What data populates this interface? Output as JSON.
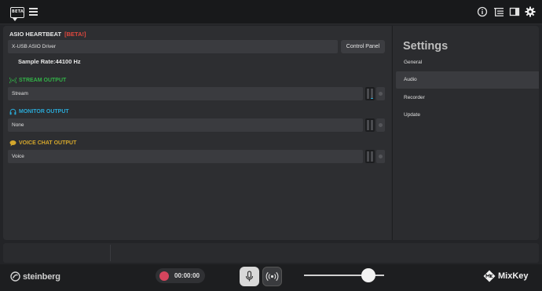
{
  "topbar": {
    "beta_logo_text": "BETA",
    "icons": [
      "info-icon",
      "list-tree-icon",
      "sidebar-toggle-icon",
      "gear-icon"
    ]
  },
  "asio": {
    "title": "ASIO HEARTBEAT",
    "beta_tag": "[BETA!]",
    "driver_value": "X-USB ASIO Driver",
    "control_panel_label": "Control Panel",
    "sample_rate": "Sample Rate:44100 Hz"
  },
  "outputs": {
    "stream": {
      "label": "STREAM OUTPUT",
      "value": "Stream",
      "color": "#33b248"
    },
    "monitor": {
      "label": "MONITOR OUTPUT",
      "value": "None",
      "color": "#2aa9d6"
    },
    "voice": {
      "label": "VOICE CHAT OUTPUT",
      "value": "Voice",
      "color": "#d4a72c"
    }
  },
  "settings": {
    "title": "Settings",
    "items": [
      {
        "label": "General",
        "active": false
      },
      {
        "label": "Audio",
        "active": true
      },
      {
        "label": "Recorder",
        "active": false
      },
      {
        "label": "Update",
        "active": false
      }
    ]
  },
  "bottombar": {
    "brand_left": "steinberg",
    "record_time": "00:00:00",
    "record_color": "#d4455d",
    "volume_level": 0.8,
    "brand_right": "MixKey"
  }
}
